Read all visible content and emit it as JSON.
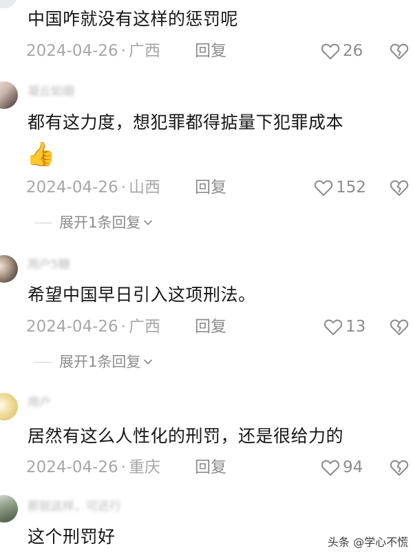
{
  "comments": [
    {
      "username": "",
      "text": "中国咋就没有这样的惩罚呢",
      "date": "2024-04-26",
      "location": "广西",
      "reply": "回复",
      "likes": "26"
    },
    {
      "username": "凝云如烟",
      "text": "都有这力度，想犯罪都得掂量下犯罪成本",
      "emoji": "👍",
      "date": "2024-04-26",
      "location": "山西",
      "reply": "回复",
      "likes": "152",
      "expand": "展开1条回复"
    },
    {
      "username": "用户5糖",
      "text": "希望中国早日引入这项刑法。",
      "date": "2024-04-26",
      "location": "广西",
      "reply": "回复",
      "likes": "13",
      "expand": "展开1条回复"
    },
    {
      "username": "用户",
      "text": "居然有这么人性化的刑罚，还是很给力的",
      "date": "2024-04-26",
      "location": "重庆",
      "reply": "回复",
      "likes": "94"
    },
    {
      "username": "那就这样，可还行",
      "text": "这个刑罚好"
    }
  ],
  "separator": "·",
  "watermark": "头条 @学心不慌",
  "colors": {
    "text": "#161616",
    "meta": "#a7a7a7",
    "action": "#8c8c8c"
  }
}
